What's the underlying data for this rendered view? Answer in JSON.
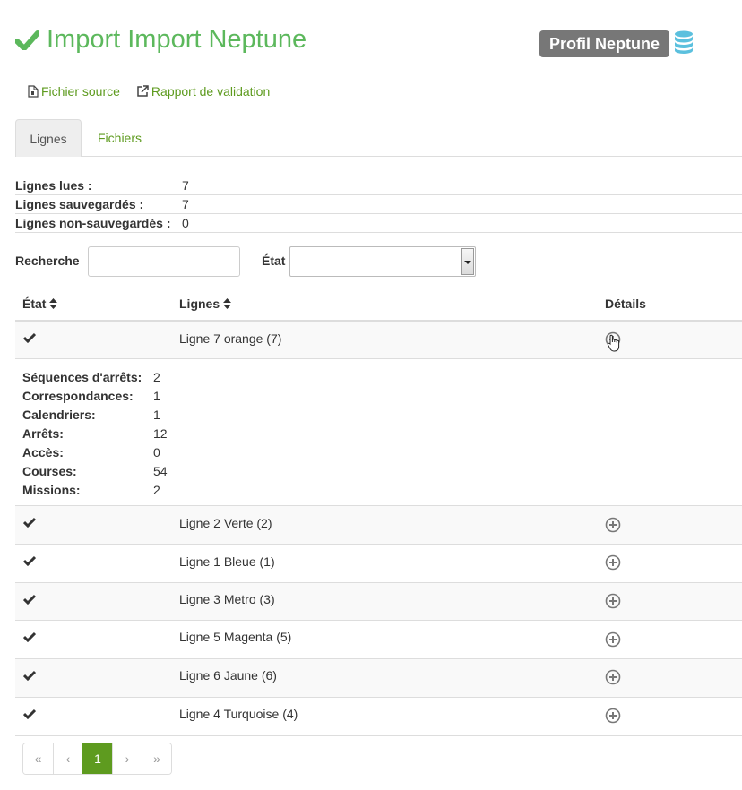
{
  "header": {
    "title": "Import Import Neptune",
    "profile_badge": "Profil Neptune",
    "title_color": "#5cb85c",
    "badge_color": "#777777",
    "db_icon_color": "#5bc0de"
  },
  "actions": {
    "source_file": "Fichier source",
    "validation_report": "Rapport de validation"
  },
  "tabs": [
    {
      "label": "Lignes",
      "active": true
    },
    {
      "label": "Fichiers",
      "active": false
    }
  ],
  "summary": [
    {
      "label": "Lignes lues :",
      "value": "7"
    },
    {
      "label": "Lignes sauvegardés :",
      "value": "7"
    },
    {
      "label": "Lignes non-sauvegardés :",
      "value": "0"
    }
  ],
  "filters": {
    "search_label": "Recherche",
    "search_value": "",
    "state_label": "État",
    "state_value": ""
  },
  "table": {
    "headers": {
      "state": "État",
      "lines": "Lignes",
      "details": "Détails"
    },
    "rows": [
      {
        "name": "Ligne 7 orange (7)",
        "status": "check",
        "expanded": true
      },
      {
        "name": "Ligne 2 Verte (2)",
        "status": "check",
        "expanded": false
      },
      {
        "name": "Ligne 1 Bleue (1)",
        "status": "check",
        "expanded": false
      },
      {
        "name": "Ligne 3 Metro (3)",
        "status": "check",
        "expanded": false
      },
      {
        "name": "Ligne 5 Magenta (5)",
        "status": "check",
        "expanded": false
      },
      {
        "name": "Ligne 6 Jaune (6)",
        "status": "check",
        "expanded": false
      },
      {
        "name": "Ligne 4 Turquoise (4)",
        "status": "check",
        "expanded": false
      }
    ],
    "details": [
      {
        "label": "Séquences d'arrêts:",
        "value": "2"
      },
      {
        "label": "Correspondances:",
        "value": "1"
      },
      {
        "label": "Calendriers:",
        "value": "1"
      },
      {
        "label": "Arrêts:",
        "value": "12"
      },
      {
        "label": "Accès:",
        "value": "0"
      },
      {
        "label": "Courses:",
        "value": "54"
      },
      {
        "label": "Missions:",
        "value": "2"
      }
    ]
  },
  "pagination": {
    "first": "«",
    "prev": "‹",
    "current": "1",
    "next": "›",
    "last": "»",
    "accent": "#5e9b1f"
  }
}
